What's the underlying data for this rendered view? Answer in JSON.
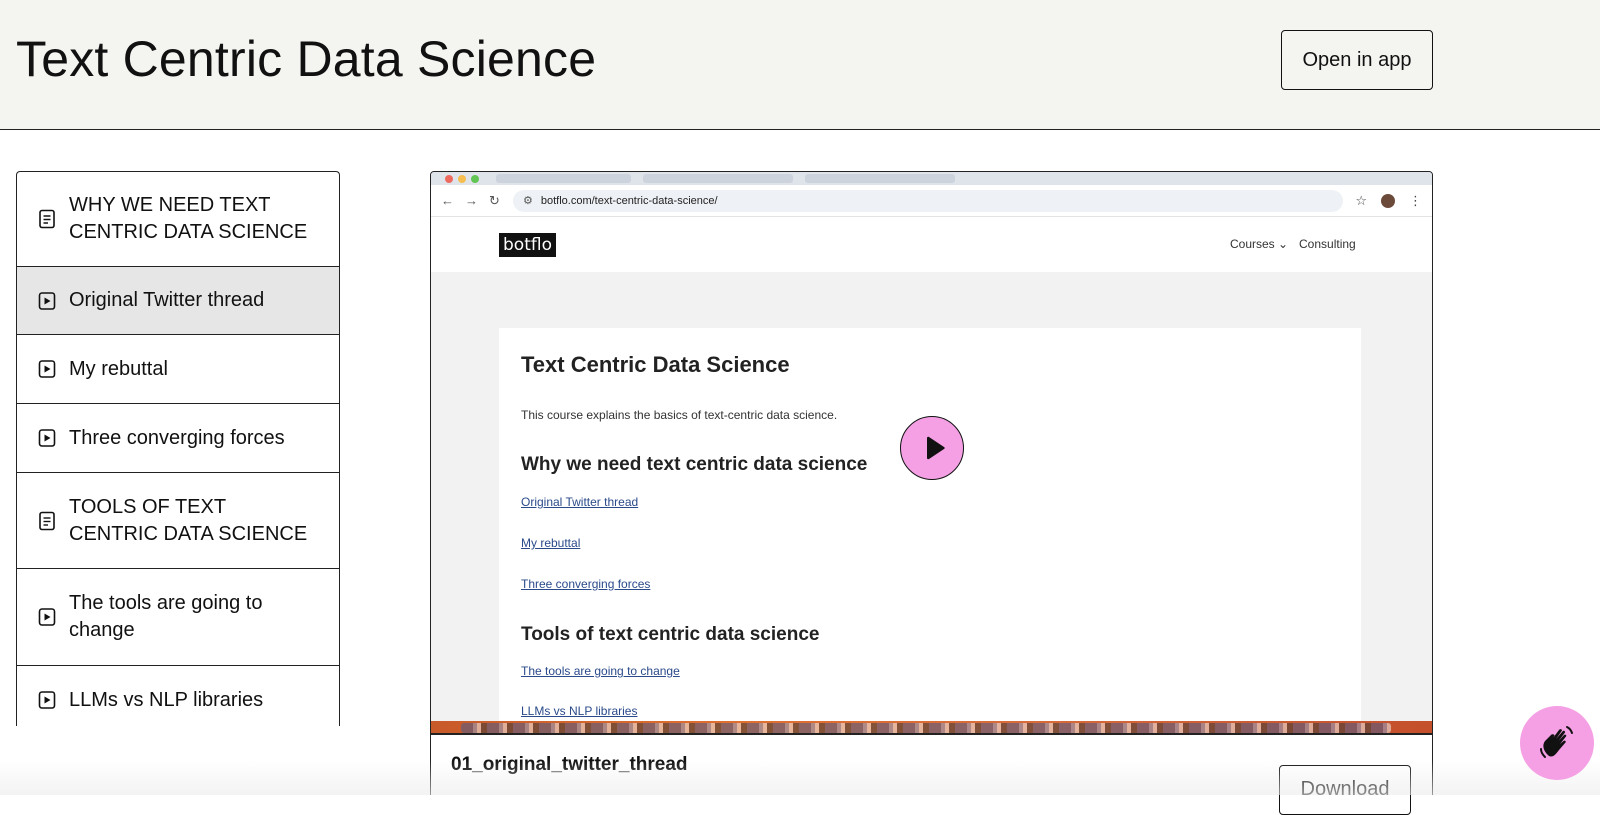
{
  "header": {
    "title": "Text Centric Data Science",
    "open_in_app": "Open in app"
  },
  "sidebar": {
    "items": [
      {
        "label": "WHY WE NEED TEXT CENTRIC DATA SCIENCE",
        "icon": "document-icon",
        "active": false
      },
      {
        "label": "Original Twitter thread",
        "icon": "video-icon",
        "active": true
      },
      {
        "label": "My rebuttal",
        "icon": "video-icon",
        "active": false
      },
      {
        "label": "Three converging forces",
        "icon": "video-icon",
        "active": false
      },
      {
        "label": "TOOLS OF TEXT CENTRIC DATA SCIENCE",
        "icon": "document-icon",
        "active": false
      },
      {
        "label": "The tools are going to change",
        "icon": "video-icon",
        "active": false
      },
      {
        "label": "LLMs vs NLP libraries",
        "icon": "video-icon",
        "active": false
      }
    ]
  },
  "video": {
    "browser": {
      "url": "botflo.com/text-centric-data-science/"
    },
    "site": {
      "logo": "botflo",
      "nav_courses": "Courses ⌄",
      "nav_consulting": "Consulting",
      "title": "Text Centric Data Science",
      "description": "This course explains the basics of text-centric data science.",
      "section1": "Why we need text centric data science",
      "section1_links": [
        "Original Twitter thread",
        "My rebuttal",
        "Three converging forces"
      ],
      "section2": "Tools of text centric data science",
      "section2_links": [
        "The tools are going to change",
        "LLMs vs NLP libraries"
      ]
    },
    "play_icon": "play-icon"
  },
  "file": {
    "name": "01_original_twitter_thread",
    "download": "Download"
  },
  "colors": {
    "accent_pink": "#f5a0e4",
    "header_bg": "#f4f4f0",
    "active_item_bg": "#e6e6e6"
  }
}
